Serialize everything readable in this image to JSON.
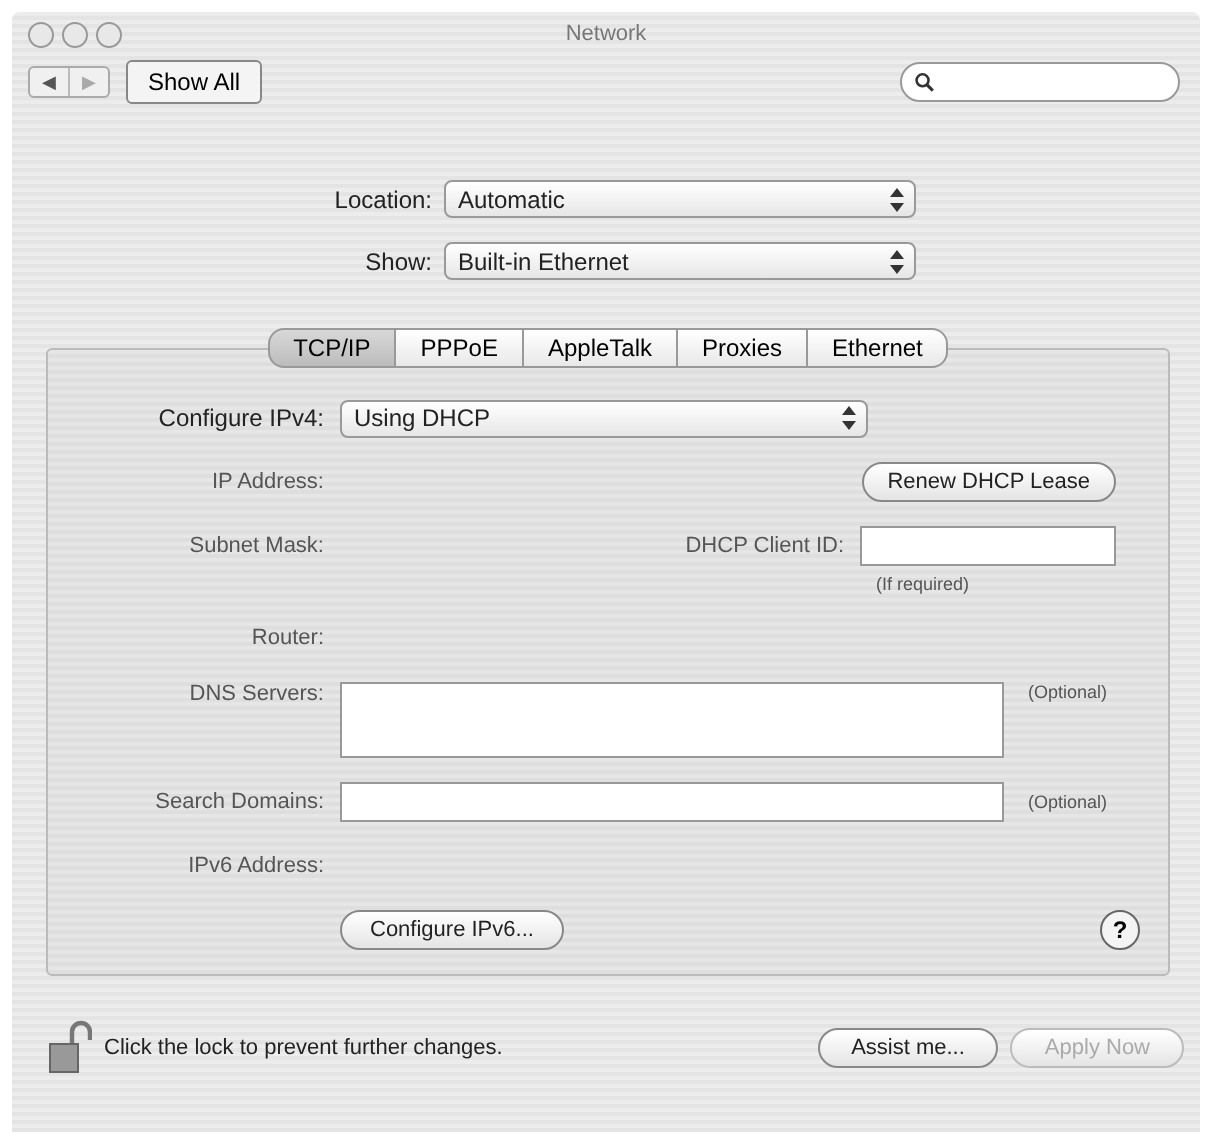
{
  "window": {
    "title": "Network"
  },
  "toolbar": {
    "back": "◀",
    "forward": "▶",
    "show_all": "Show All"
  },
  "location": {
    "label": "Location:",
    "value": "Automatic"
  },
  "show": {
    "label": "Show:",
    "value": "Built-in Ethernet"
  },
  "tabs": [
    {
      "label": "TCP/IP",
      "selected": true
    },
    {
      "label": "PPPoE",
      "selected": false
    },
    {
      "label": "AppleTalk",
      "selected": false
    },
    {
      "label": "Proxies",
      "selected": false
    },
    {
      "label": "Ethernet",
      "selected": false
    }
  ],
  "configure_ipv4": {
    "label": "Configure IPv4:",
    "value": "Using DHCP"
  },
  "ip_address": {
    "label": "IP Address:",
    "button": "Renew DHCP Lease"
  },
  "subnet_mask": {
    "label": "Subnet Mask:"
  },
  "dhcp_client_id": {
    "label": "DHCP Client ID:",
    "hint": "(If required)"
  },
  "router": {
    "label": "Router:"
  },
  "dns_servers": {
    "label": "DNS Servers:",
    "note": "(Optional)"
  },
  "search_domains": {
    "label": "Search Domains:",
    "note": "(Optional)"
  },
  "ipv6_address": {
    "label": "IPv6 Address:"
  },
  "configure_ipv6": "Configure IPv6...",
  "help": "?",
  "footer": {
    "lock_text": "Click the lock to prevent further changes.",
    "assist": {
      "label": "Assist me...",
      "disabled": false
    },
    "apply": {
      "label": "Apply Now",
      "disabled": true
    }
  }
}
